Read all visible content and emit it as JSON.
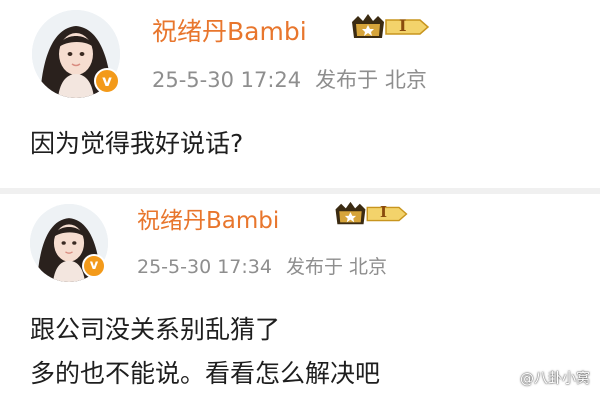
{
  "posts": [
    {
      "username": "祝绪丹Bambi",
      "badge_text": "I",
      "verified_symbol": "v",
      "timestamp": "25-5-30 17:24",
      "location": "发布于 北京",
      "content_lines": [
        "因为觉得我好说话?"
      ]
    },
    {
      "username": "祝绪丹Bambi",
      "badge_text": "I",
      "verified_symbol": "v",
      "timestamp": "25-5-30 17:34",
      "location": "发布于 北京",
      "content_lines": [
        "跟公司没关系别乱猜了",
        "多的也不能说。看看怎么解决吧"
      ]
    }
  ],
  "watermark": "@八卦小窝",
  "colors": {
    "username": "#e8762d",
    "meta_text": "#8e8e8e",
    "content_text": "#1e1e1e",
    "verified_badge": "#f39a1a",
    "crown_gold": "#b8860b",
    "divider": "#f0f0f0"
  },
  "icons": {
    "avatar": "profile-photo",
    "verified": "verified-v-badge-icon",
    "member": "crown-member-level-badge-icon"
  }
}
